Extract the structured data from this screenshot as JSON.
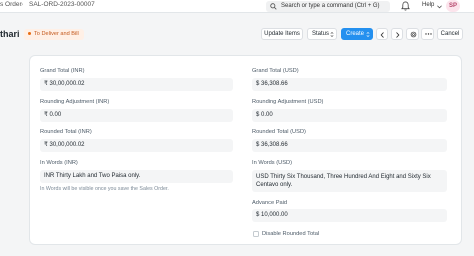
{
  "nav": {
    "breadcrumb_parent": "s Order",
    "breadcrumb_current": "SAL-ORD-2023-00007",
    "search_placeholder": "Search or type a command (Ctrl + G)",
    "help_label": "Help",
    "avatar_initials": "SP"
  },
  "header": {
    "title": "thari",
    "status": "To Deliver and Bill",
    "update_items": "Update Items",
    "status_menu": "Status",
    "create": "Create",
    "cancel": "Cancel"
  },
  "form": {
    "grand_total_inr_label": "Grand Total (INR)",
    "grand_total_inr_value": "₹ 30,00,000.02",
    "grand_total_usd_label": "Grand Total (USD)",
    "grand_total_usd_value": "$ 36,308.66",
    "rounding_inr_label": "Rounding Adjustment (INR)",
    "rounding_inr_value": "₹ 0.00",
    "rounding_usd_label": "Rounding Adjustment (USD)",
    "rounding_usd_value": "$ 0.00",
    "rounded_inr_label": "Rounded Total (INR)",
    "rounded_inr_value": "₹ 30,00,000.02",
    "rounded_usd_label": "Rounded Total (USD)",
    "rounded_usd_value": "$ 36,308.66",
    "words_inr_label": "In Words (INR)",
    "words_inr_value": "INR Thirty Lakh and Two Paisa only.",
    "words_inr_hint": "In Words will be visible once you save the Sales Order.",
    "words_usd_label": "In Words (USD)",
    "words_usd_value": "USD Thirty Six Thousand, Three Hundred And Eight and Sixty Six Centavo only.",
    "advance_paid_label": "Advance Paid",
    "advance_paid_value": "$ 10,000.00",
    "disable_rounded_label": "Disable Rounded Total"
  },
  "colors": {
    "primary": "#2490ef",
    "status_text": "#c4581c",
    "status_bg": "#fff0e6"
  }
}
